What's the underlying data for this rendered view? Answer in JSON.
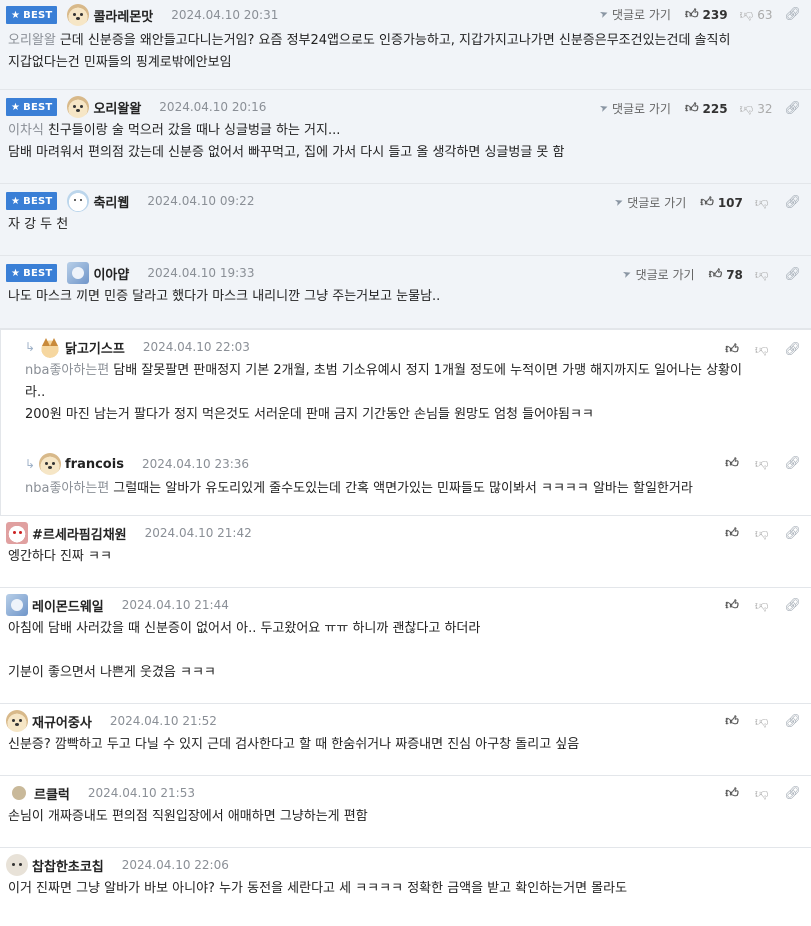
{
  "labels": {
    "best": "BEST",
    "reply": "댓글로 가기"
  },
  "comments": [
    {
      "nick": "콜라레몬맛",
      "date": "2024.04.10 20:31",
      "up": "239",
      "down": "63",
      "mention": "오리왈왈",
      "lines": [
        "근데 신분증을 왜안들고다니는거임? 요즘 정부24앱으로도 인증가능하고, 지갑가지고나가면 신분증은무조건있는건데 솔직히",
        "지갑없다는건 민짜들의 핑계로밖에안보임"
      ]
    },
    {
      "nick": "오리왈왈",
      "date": "2024.04.10 20:16",
      "up": "225",
      "down": "32",
      "mention": "이차식",
      "lines": [
        "친구들이랑 술 먹으러 갔을 때나 싱글벙글 하는 거지...",
        "담배 마려워서 편의점 갔는데 신분증 없어서 빠꾸먹고, 집에 가서 다시 들고 올 생각하면 싱글벙글 못 함"
      ]
    },
    {
      "nick": "축리웹",
      "date": "2024.04.10 09:22",
      "up": "107",
      "lines": [
        "자 강 두 천"
      ]
    },
    {
      "nick": "이아얍",
      "date": "2024.04.10 19:33",
      "up": "78",
      "lines": [
        "나도 마스크 끼면 민증 달라고 했다가 마스크 내리니깐 그냥 주는거보고 눈물남.."
      ]
    },
    {
      "nick": "닭고기스프",
      "date": "2024.04.10 22:03",
      "mention": "nba좋아하는편",
      "lines": [
        "담배 잘못팔면 판매정지 기본 2개월, 초범 기소유예시 정지 1개월 정도에 누적이면 가맹 해지까지도 일어나는 상황이",
        "라..",
        "200원 마진 남는거 팔다가 정지 먹은것도 서러운데 판매 금지 기간동안 손님들 원망도 엄청 들어야됨ㅋㅋ"
      ]
    },
    {
      "nick": "francois",
      "date": "2024.04.10 23:36",
      "mention": "nba좋아하는편",
      "lines": [
        "그럴때는 알바가 유도리있게 줄수도있는데 간혹 액면가있는 민짜들도 많이봐서 ㅋㅋㅋㅋ 알바는 할일한거라"
      ]
    },
    {
      "nick": "#르세라핌김채원",
      "date": "2024.04.10 21:42",
      "lines": [
        "엥간하다 진짜 ㅋㅋ"
      ]
    },
    {
      "nick": "레이몬드웨일",
      "date": "2024.04.10 21:44",
      "lines": [
        "아침에 담배 사러갔을 때 신분증이 없어서 아.. 두고왔어요 ㅠㅠ 하니까 괜찮다고 하더라",
        "",
        "기분이 좋으면서 나쁜게 웃겼음 ㅋㅋㅋ"
      ]
    },
    {
      "nick": "재규어중사",
      "date": "2024.04.10 21:52",
      "lines": [
        "신분증? 깜빡하고 두고 다닐 수 있지 근데 검사한다고 할 때 한숨쉬거나 짜증내면 진심 아구창 돌리고 싶음"
      ]
    },
    {
      "nick": "르클럭",
      "date": "2024.04.10 21:53",
      "lines": [
        "손님이 개짜증내도 편의점 직원입장에서 애매하면 그냥하는게 편함"
      ]
    },
    {
      "nick": "찹찹한초코칩",
      "date": "2024.04.10 22:06",
      "lines": [
        "이거 진짜면 그냥 알바가 바보 아니야? 누가 동전을 세란다고 세 ㅋㅋㅋㅋ 정확한 금액을 받고 확인하는거면 몰라도"
      ]
    }
  ]
}
